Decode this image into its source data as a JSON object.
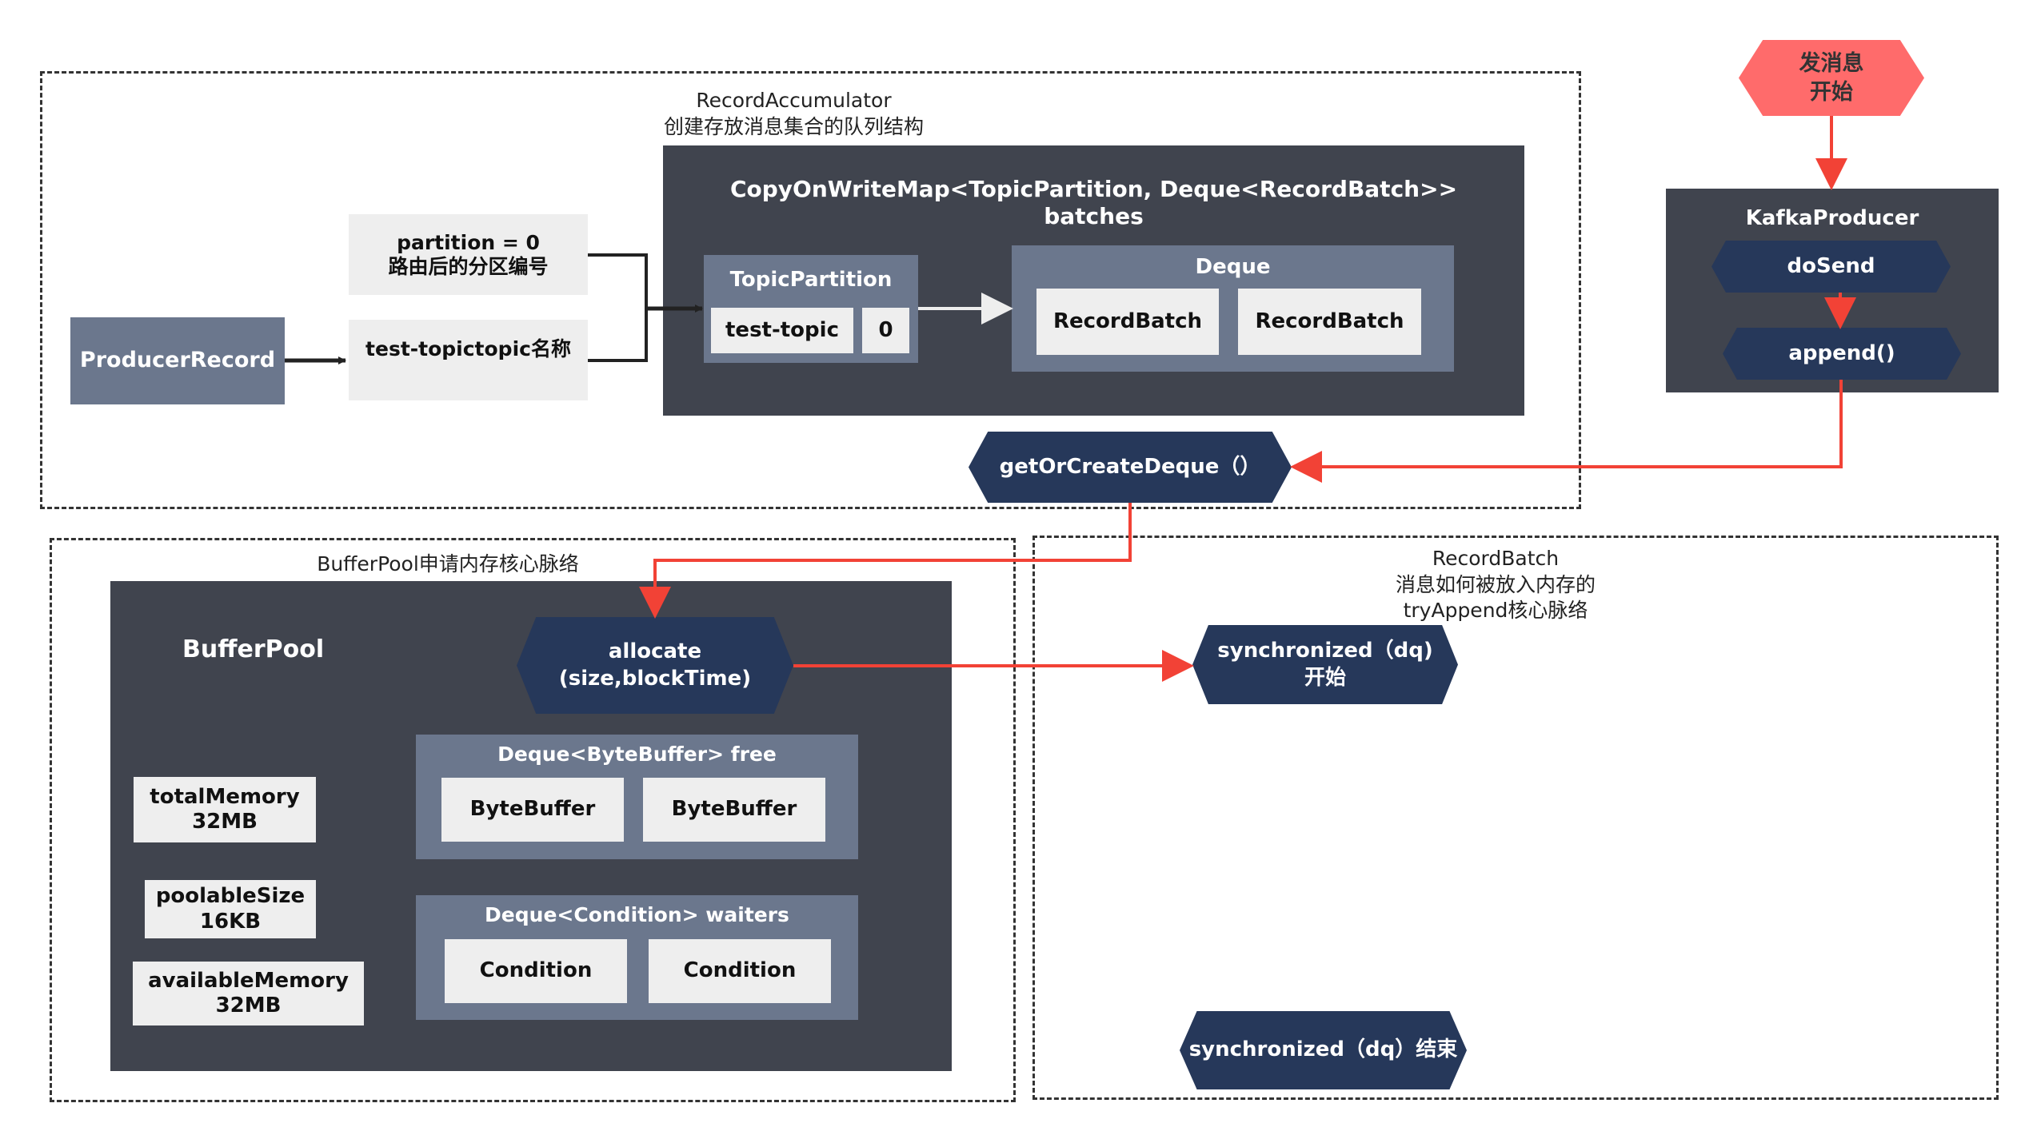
{
  "colors": {
    "dark_panel": "#40444e",
    "slate_panel": "#6b778d",
    "light_cell": "#eeeeee",
    "navy_hex": "#26385a",
    "start_hex": "#ff6b6b",
    "flow_arrow": "#f24236",
    "data_arrow": "#222222"
  },
  "start": {
    "line1": "发消息",
    "line2": "开始"
  },
  "kafka_producer": {
    "title": "KafkaProducer",
    "do_send": "doSend",
    "append": "append()"
  },
  "record_accumulator": {
    "caption_line1": "RecordAccumulator",
    "caption_line2": "创建存放消息集合的队列结构",
    "map_title_line1": "CopyOnWriteMap<TopicPartition, Deque<RecordBatch>>",
    "map_title_line2": "batches",
    "topic_partition": {
      "title": "TopicPartition",
      "topic": "test-topic",
      "partition": "0"
    },
    "deque": {
      "title": "Deque",
      "items": [
        "RecordBatch",
        "RecordBatch"
      ]
    },
    "producer_record": "ProducerRecord",
    "partition_note": {
      "line1": "partition = 0",
      "line2": "路由后的分区编号"
    },
    "topic_note": "test-topictopic名称",
    "get_or_create_deque": "getOrCreateDeque（）"
  },
  "buffer_pool": {
    "caption": "BufferPool申请内存核心脉络",
    "title": "BufferPool",
    "allocate": {
      "line1": "allocate",
      "line2": "(size,blockTime)"
    },
    "free_deque": {
      "title": "Deque<ByteBuffer> free",
      "items": [
        "ByteBuffer",
        "ByteBuffer"
      ]
    },
    "waiters_deque": {
      "title": "Deque<Condition> waiters",
      "items": [
        "Condition",
        "Condition"
      ]
    },
    "stats": [
      {
        "name": "totalMemory",
        "value": "32MB"
      },
      {
        "name": "poolableSize",
        "value": "16KB"
      },
      {
        "name": "availableMemory",
        "value": "32MB"
      }
    ]
  },
  "record_batch": {
    "caption_line1": "RecordBatch",
    "caption_line2": "消息如何被放入内存的",
    "caption_line3": "tryAppend核心脉络",
    "sync_start": {
      "line1": "synchronized（dq)",
      "line2": "开始"
    },
    "sync_end": "synchronized（dq）结束"
  }
}
